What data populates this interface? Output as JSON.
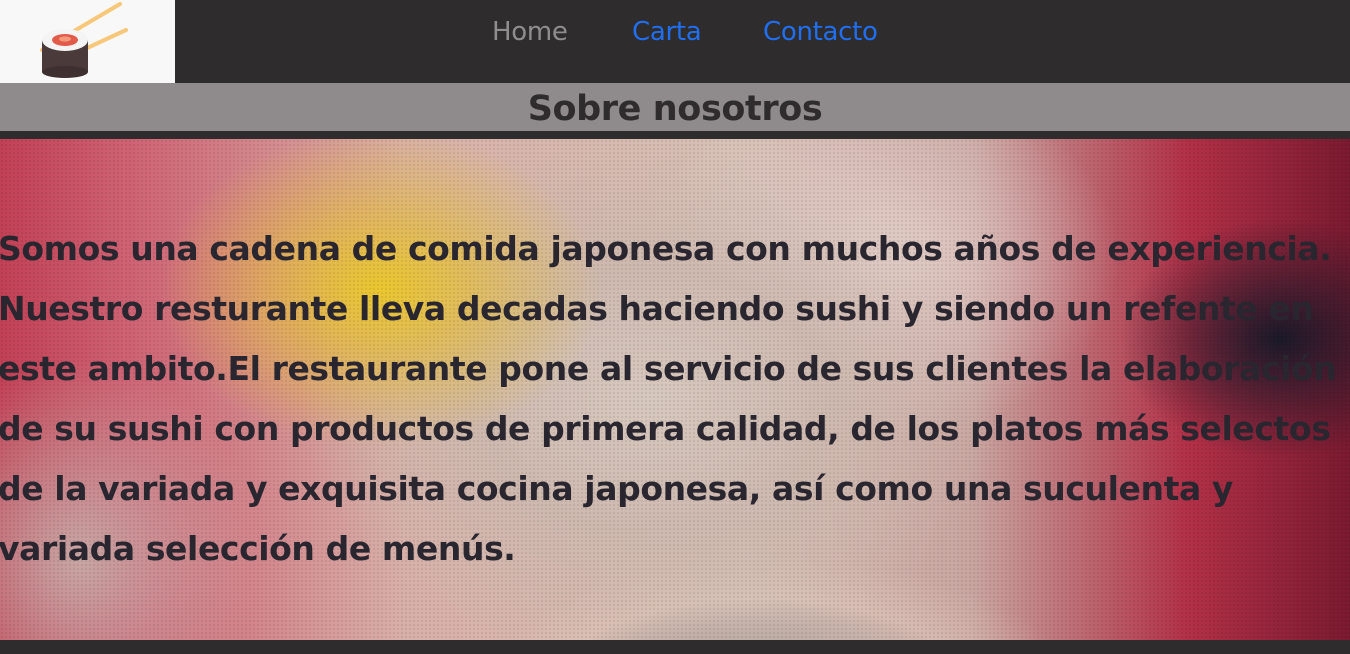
{
  "nav": {
    "logo_icon": "sushi-logo-icon",
    "links": [
      {
        "label": "Home",
        "color": "#8e8e8e"
      },
      {
        "label": "Carta",
        "color": "#1f6ff0"
      },
      {
        "label": "Contacto",
        "color": "#1f6ff0"
      }
    ]
  },
  "section": {
    "title": "Sobre nosotros"
  },
  "about": {
    "text": "Somos una cadena de comida japonesa con muchos años de experiencia. Nuestro resturante lleva decadas haciendo sushi y siendo un refente en este ambito.El restaurante pone al servicio de sus clientes la elaboración de su sushi con productos de primera calidad, de los platos más selectos de la variada y exquisita cocina japonesa, así como una suculenta y variada selección de menús."
  },
  "colors": {
    "navbar_bg": "#2f2c2d",
    "section_bar_bg": "#8f8a8b",
    "link_active": "#1f6ff0",
    "link_muted": "#8e8e8e"
  }
}
